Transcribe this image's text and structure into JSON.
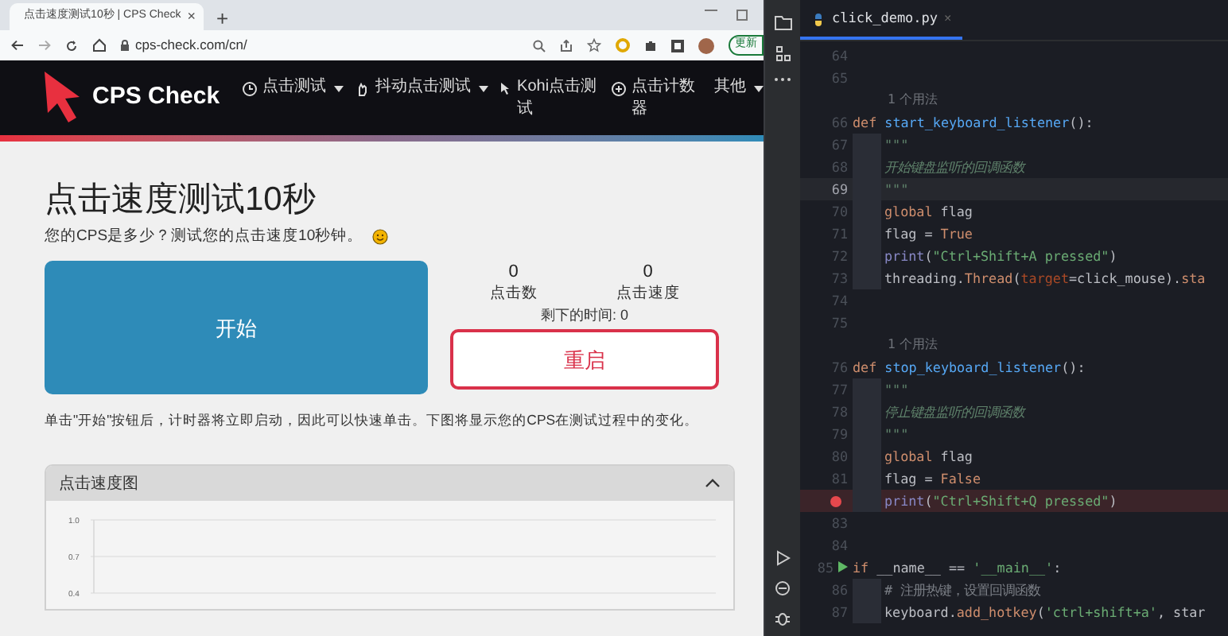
{
  "browser": {
    "tab": {
      "title": "点击速度测试10秒 | CPS Check",
      "close": "×"
    },
    "new_tab": "+",
    "address": "cps-check.com/cn/",
    "update_button": "更新",
    "site": {
      "logo": "CPS Check",
      "nav": [
        {
          "label": "点击测试",
          "dropdown": true
        },
        {
          "label": "抖动点击测试",
          "dropdown": true
        },
        {
          "label": "Kohi点击测试",
          "dropdown": false
        },
        {
          "label": "点击计数器",
          "dropdown": false
        },
        {
          "label": "其他",
          "dropdown": true
        }
      ],
      "title": "点击速度测试10秒",
      "subtitle": "您的CPS是多少？测试您的点击速度10秒钟。",
      "start_button": "开始",
      "stats": [
        {
          "value": "0",
          "label": "点击数"
        },
        {
          "value": "0",
          "label": "点击速度"
        }
      ],
      "time_left": "剩下的时间: 0",
      "restart_button": "重启",
      "description": "单击\"开始\"按钮后，计时器将立即启动，因此可以快速单击。下图将显示您的CPS在测试过程中的变化。",
      "chart_panel": {
        "title": "点击速度图",
        "expanded": true,
        "chart_data": {
          "type": "line",
          "categories": [
            null
          ],
          "ylim": [
            0.4,
            1
          ],
          "yticks": [
            {
              "value": 1,
              "label": "1.0"
            },
            {
              "value": 0.7,
              "label": "0.7"
            },
            {
              "value": 0.4,
              "label": "0.4"
            }
          ]
        }
      }
    }
  },
  "editor": {
    "tab": {
      "title": "click_demo.py",
      "close": "×"
    },
    "lines": [
      {
        "kind": "code",
        "number": "64"
      },
      {
        "kind": "code",
        "number": "65"
      },
      {
        "kind": "hint",
        "text": "1 个用法"
      },
      {
        "kind": "code",
        "number": "66",
        "segments": [
          {
            "text": "def ",
            "kind": "keyword"
          },
          {
            "text": "start_keyboard_listener",
            "kind": "function"
          },
          {
            "text": "():",
            "kind": "plain"
          }
        ]
      },
      {
        "kind": "code",
        "number": "67",
        "indent": true,
        "segments": [
          {
            "text": "\"\"\"",
            "kind": "docstring"
          }
        ]
      },
      {
        "kind": "code",
        "number": "68",
        "indent": true,
        "segments": [
          {
            "text": "开始键盘监听的回调函数",
            "kind": "docstring"
          }
        ]
      },
      {
        "kind": "code",
        "number": "69",
        "indent": true,
        "current": true,
        "segments": [
          {
            "text": "\"\"\"",
            "kind": "docstring"
          }
        ]
      },
      {
        "kind": "code",
        "number": "70",
        "indent": true,
        "segments": [
          {
            "text": "global",
            "kind": "keyword"
          },
          {
            "text": " flag",
            "kind": "plain"
          }
        ]
      },
      {
        "kind": "code",
        "number": "71",
        "indent": true,
        "segments": [
          {
            "text": "flag = ",
            "kind": "plain"
          },
          {
            "text": "True",
            "kind": "keyword"
          }
        ]
      },
      {
        "kind": "code",
        "number": "72",
        "indent": true,
        "segments": [
          {
            "text": "print",
            "kind": "builtin"
          },
          {
            "text": "(",
            "kind": "plain"
          },
          {
            "text": "\"Ctrl+Shift+A pressed\"",
            "kind": "string"
          },
          {
            "text": ")",
            "kind": "plain"
          }
        ]
      },
      {
        "kind": "code",
        "number": "73",
        "indent": true,
        "segments": [
          {
            "text": "threading.",
            "kind": "plain"
          },
          {
            "text": "Thread",
            "kind": "keyword"
          },
          {
            "text": "(",
            "kind": "plain"
          },
          {
            "text": "target",
            "kind": "parameter"
          },
          {
            "text": "=click_mouse).",
            "kind": "plain"
          },
          {
            "text": "sta",
            "kind": "keyword"
          }
        ]
      },
      {
        "kind": "code",
        "number": "74"
      },
      {
        "kind": "code",
        "number": "75"
      },
      {
        "kind": "hint",
        "text": "1 个用法"
      },
      {
        "kind": "code",
        "number": "76",
        "segments": [
          {
            "text": "def ",
            "kind": "keyword"
          },
          {
            "text": "stop_keyboard_listener",
            "kind": "function"
          },
          {
            "text": "():",
            "kind": "plain"
          }
        ]
      },
      {
        "kind": "code",
        "number": "77",
        "indent": true,
        "segments": [
          {
            "text": "\"\"\"",
            "kind": "docstring"
          }
        ]
      },
      {
        "kind": "code",
        "number": "78",
        "indent": true,
        "segments": [
          {
            "text": "停止键盘监听的回调函数",
            "kind": "docstring"
          }
        ]
      },
      {
        "kind": "code",
        "number": "79",
        "indent": true,
        "segments": [
          {
            "text": "\"\"\"",
            "kind": "docstring"
          }
        ]
      },
      {
        "kind": "code",
        "number": "80",
        "indent": true,
        "segments": [
          {
            "text": "global",
            "kind": "keyword"
          },
          {
            "text": " flag",
            "kind": "plain"
          }
        ]
      },
      {
        "kind": "code",
        "number": "81",
        "indent": true,
        "segments": [
          {
            "text": "flag = ",
            "kind": "plain"
          },
          {
            "text": "False",
            "kind": "keyword"
          }
        ]
      },
      {
        "kind": "code",
        "breakpoint": true,
        "indent": true,
        "segments": [
          {
            "text": "print",
            "kind": "builtin"
          },
          {
            "text": "(",
            "kind": "plain"
          },
          {
            "text": "\"Ctrl+Shift+Q pressed\"",
            "kind": "string"
          },
          {
            "text": ")",
            "kind": "plain"
          }
        ]
      },
      {
        "kind": "code",
        "number": "83"
      },
      {
        "kind": "code",
        "number": "84"
      },
      {
        "kind": "code",
        "number": "85",
        "run": true,
        "segments": [
          {
            "text": "if",
            "kind": "keyword"
          },
          {
            "text": " __name__ == ",
            "kind": "plain"
          },
          {
            "text": "'__main__'",
            "kind": "string"
          },
          {
            "text": ":",
            "kind": "plain"
          }
        ]
      },
      {
        "kind": "code",
        "number": "86",
        "indent": true,
        "segments": [
          {
            "text": "# 注册热键，设置回调函数",
            "kind": "comment"
          }
        ]
      },
      {
        "kind": "code",
        "number": "87",
        "indent": true,
        "segments": [
          {
            "text": "keyboard.",
            "kind": "plain"
          },
          {
            "text": "add_hotkey",
            "kind": "keyword"
          },
          {
            "text": "(",
            "kind": "plain"
          },
          {
            "text": "'ctrl+shift+a'",
            "kind": "string"
          },
          {
            "text": ", star",
            "kind": "plain"
          }
        ]
      }
    ]
  }
}
